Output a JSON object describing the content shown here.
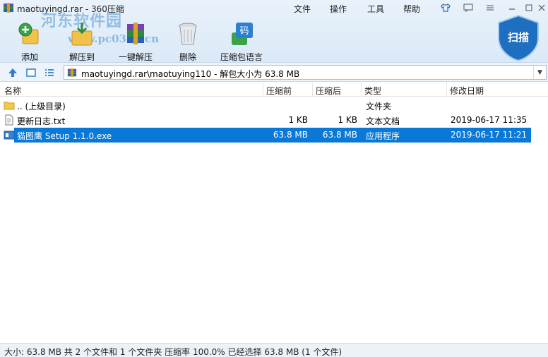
{
  "window": {
    "title": "maotuyingd.rar - 360压缩",
    "menu": [
      "文件",
      "操作",
      "工具",
      "帮助"
    ]
  },
  "watermark": {
    "line1": "河东软件园",
    "line2": "www.pc0359.cn"
  },
  "toolbar": {
    "add": "添加",
    "extract_to": "解压到",
    "one_click_extract": "一键解压",
    "delete": "删除",
    "language": "压缩包语言",
    "scan": "扫描"
  },
  "address": {
    "path": "maotuyingd.rar\\maotuying110 - 解包大小为 63.8 MB"
  },
  "columns": {
    "name": "名称",
    "packed": "压缩前",
    "unpacked": "压缩后",
    "type": "类型",
    "modified": "修改日期"
  },
  "files": [
    {
      "name": ".. (上级目录)",
      "packed": "",
      "unpacked": "",
      "type": "文件夹",
      "modified": "",
      "icon": "folder-icon",
      "selected": false
    },
    {
      "name": "更新日志.txt",
      "packed": "1 KB",
      "unpacked": "1 KB",
      "type": "文本文档",
      "modified": "2019-06-17 11:35",
      "icon": "text-file-icon",
      "selected": false
    },
    {
      "name": "猫图鹰 Setup 1.1.0.exe",
      "packed": "63.8 MB",
      "unpacked": "63.8 MB",
      "type": "应用程序",
      "modified": "2019-06-17 11:21",
      "icon": "exe-file-icon",
      "selected": true
    }
  ],
  "status": {
    "text": "大小: 63.8 MB 共 2 个文件和 1 个文件夹 压缩率 100.0% 已经选择 63.8 MB (1 个文件)"
  },
  "colors": {
    "selection": "#0a78d7",
    "chrome": "#dbe9f7",
    "scan_shield": "#1f6fc0"
  }
}
